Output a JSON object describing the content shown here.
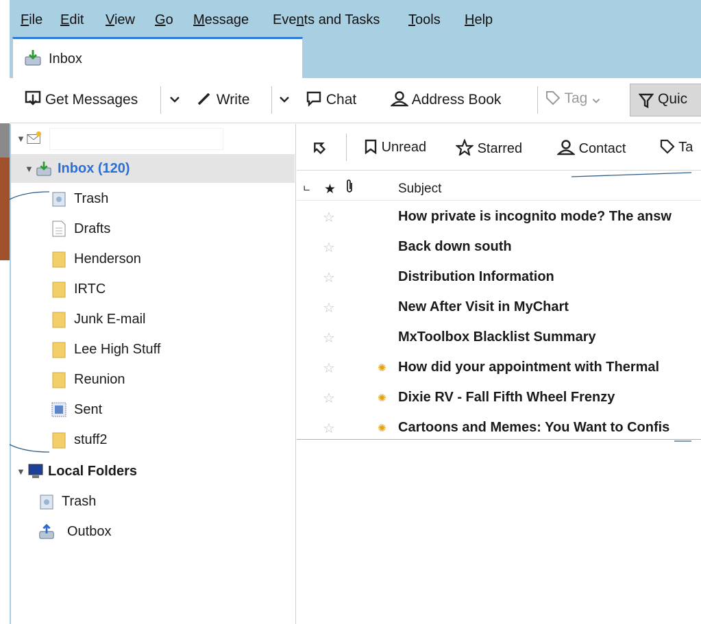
{
  "menubar": {
    "items": [
      {
        "pre": "",
        "u": "F",
        "post": "ile"
      },
      {
        "pre": "",
        "u": "E",
        "post": "dit"
      },
      {
        "pre": "",
        "u": "V",
        "post": "iew"
      },
      {
        "pre": "",
        "u": "G",
        "post": "o"
      },
      {
        "pre": "",
        "u": "M",
        "post": "essage"
      },
      {
        "pre": "Eve",
        "u": "n",
        "post": "ts and Tasks"
      },
      {
        "pre": "",
        "u": "T",
        "post": "ools"
      },
      {
        "pre": "",
        "u": "H",
        "post": "elp"
      }
    ]
  },
  "tabs": [
    {
      "label": "Inbox"
    }
  ],
  "toolbar": {
    "get_messages": "Get Messages",
    "write": "Write",
    "chat": "Chat",
    "address_book": "Address Book",
    "tag": "Tag",
    "quick_filter": "Quic"
  },
  "folders": {
    "inbox": "Inbox (120)",
    "items": [
      "Trash",
      "Drafts",
      "Henderson",
      "IRTC",
      "Junk E-mail",
      "Lee High Stuff",
      "Reunion",
      "Sent",
      "stuff2"
    ],
    "local_folders": "Local Folders",
    "local_items": [
      "Trash",
      "Outbox"
    ]
  },
  "quick_filter_bar": {
    "unread": "Unread",
    "starred": "Starred",
    "contact": "Contact",
    "tags": "Ta"
  },
  "columns": {
    "subject": "Subject"
  },
  "messages": [
    {
      "subject": "How private is incognito mode? The answ",
      "new": false
    },
    {
      "subject": "Back down south",
      "new": false
    },
    {
      "subject": "Distribution Information",
      "new": false
    },
    {
      "subject": "New After Visit in MyChart",
      "new": false
    },
    {
      "subject": "MxToolbox Blacklist Summary",
      "new": false
    },
    {
      "subject": "How did your appointment with Thermal",
      "new": true
    },
    {
      "subject": "Dixie RV - Fall Fifth Wheel Frenzy",
      "new": true
    },
    {
      "subject": "Cartoons and Memes: You Want to Confis",
      "new": true
    }
  ],
  "colors": {
    "menubar_bg": "#a9cfe3",
    "accent": "#2b7bd6",
    "inbox_text": "#2a6fd6",
    "folder_yellow": "#f3cf6a",
    "new_dot": "#e3a20a"
  }
}
